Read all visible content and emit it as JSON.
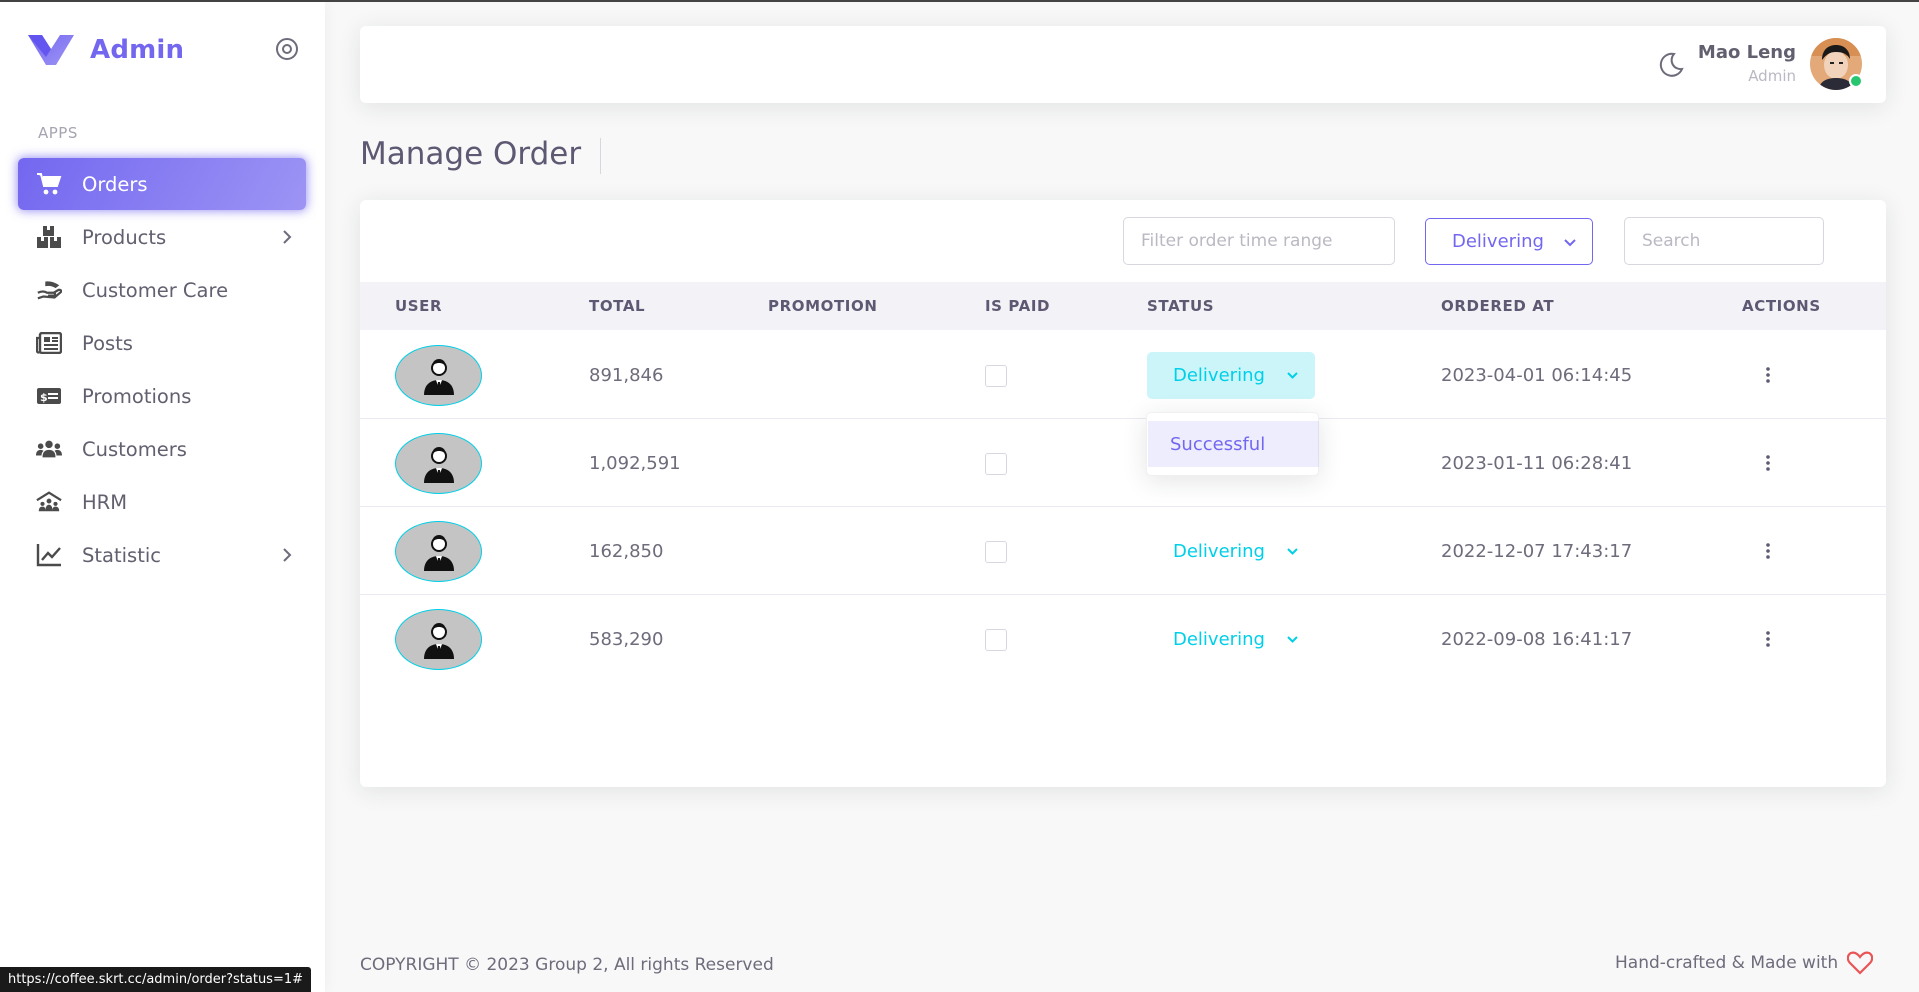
{
  "brand": {
    "name": "Admin",
    "accent": "#7367f0"
  },
  "sidebar": {
    "section_label": "APPS",
    "items": [
      {
        "label": "Orders",
        "icon": "cart-icon",
        "active": true
      },
      {
        "label": "Products",
        "icon": "boxes-icon",
        "has_children": true
      },
      {
        "label": "Customer Care",
        "icon": "hand-icon"
      },
      {
        "label": "Posts",
        "icon": "newspaper-icon"
      },
      {
        "label": "Promotions",
        "icon": "money-bill-icon"
      },
      {
        "label": "Customers",
        "icon": "users-icon"
      },
      {
        "label": "HRM",
        "icon": "people-roof-icon"
      },
      {
        "label": "Statistic",
        "icon": "chart-line-icon",
        "has_children": true
      }
    ]
  },
  "navbar": {
    "user_name": "Mao Leng",
    "user_role": "Admin",
    "online_color": "#28c76f"
  },
  "page": {
    "title": "Manage Order"
  },
  "filters": {
    "time_range_placeholder": "Filter order time range",
    "status_value": "Delivering",
    "search_placeholder": "Search"
  },
  "table": {
    "columns": [
      "USER",
      "TOTAL",
      "PROMOTION",
      "IS PAID",
      "STATUS",
      "ORDERED AT",
      "ACTIONS"
    ],
    "rows": [
      {
        "total": "891,846",
        "promotion": "",
        "is_paid": false,
        "status": "Delivering",
        "ordered_at": "2023-04-01 06:14:45"
      },
      {
        "total": "1,092,591",
        "promotion": "",
        "is_paid": false,
        "status": "",
        "ordered_at": "2023-01-11 06:28:41"
      },
      {
        "total": "162,850",
        "promotion": "",
        "is_paid": false,
        "status": "Delivering",
        "ordered_at": "2022-12-07 17:43:17"
      },
      {
        "total": "583,290",
        "promotion": "",
        "is_paid": false,
        "status": "Delivering",
        "ordered_at": "2022-09-08 16:41:17"
      }
    ]
  },
  "status_dropdown": {
    "options": [
      "Successful"
    ]
  },
  "footer": {
    "copyright": "COPYRIGHT © 2023 Group 2, All rights Reserved",
    "credit": "Hand-crafted & Made with"
  },
  "browser_status_url": "https://coffee.skrt.cc/admin/order?status=1#",
  "colors": {
    "status_info": "#00cfe8",
    "heart": "#ea5455"
  }
}
